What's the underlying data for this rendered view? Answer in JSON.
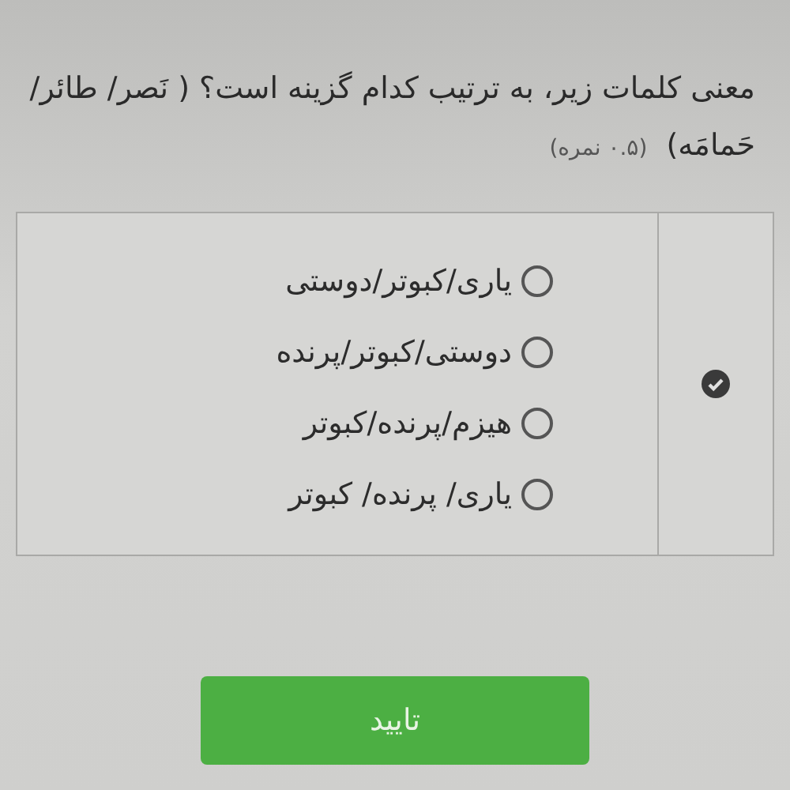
{
  "question": {
    "text": "معنی کلمات زیر، به ترتیب کدام گزینه است؟ ( نَصر/ طائر/حَمامَه)",
    "score": "(۰.۵ نمره)"
  },
  "options": [
    {
      "label": "یاری/کبوتر/دوستی",
      "selected": false
    },
    {
      "label": "دوستی/کبوتر/پرنده",
      "selected": false
    },
    {
      "label": "هیزم/پرنده/کبوتر",
      "selected": false
    },
    {
      "label": "یاری/ پرنده/ کبوتر",
      "selected": false
    }
  ],
  "submit": {
    "label": "تایید"
  }
}
